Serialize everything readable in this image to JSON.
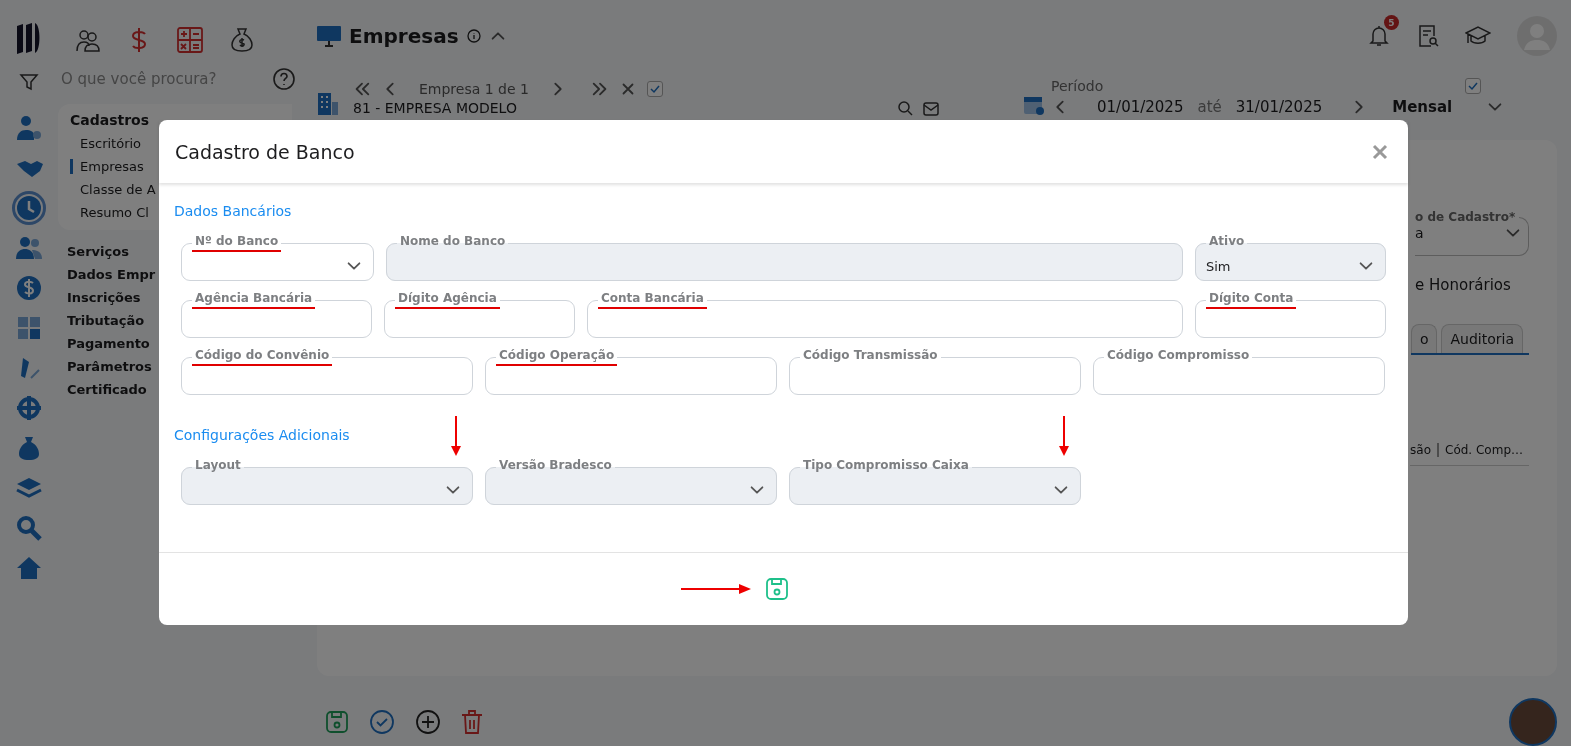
{
  "rail": [
    {
      "selected": false
    },
    {
      "selected": false
    },
    {
      "selected": true
    },
    {
      "selected": false
    },
    {
      "selected": false
    },
    {
      "selected": false
    },
    {
      "selected": false
    },
    {
      "selected": false
    },
    {
      "selected": false
    },
    {
      "selected": false
    },
    {
      "selected": false
    },
    {
      "selected": false
    }
  ],
  "search": {
    "placeholder": "O que você procura?"
  },
  "sidebar": {
    "group_title": "Cadastros",
    "items": [
      {
        "label": "Escritório",
        "selected": false
      },
      {
        "label": "Empresas",
        "selected": true
      },
      {
        "label": "Classe de A",
        "selected": false
      },
      {
        "label": "Resumo Cl",
        "selected": false
      }
    ],
    "sections": [
      "Serviços",
      "Dados Empr",
      "Inscrições",
      "Tributação",
      "Pagamento",
      "Parâmetros",
      "Certificado"
    ]
  },
  "header": {
    "title": "Empresas",
    "notifications": "5"
  },
  "company_nav": {
    "position": "Empresa 1 de 1",
    "checked": true,
    "company": "81 - EMPRESA MODELO"
  },
  "period": {
    "label": "Período",
    "start": "01/01/2025",
    "separator": "até",
    "end": "31/01/2025",
    "mode": "Mensal",
    "checked": true
  },
  "panel": {
    "select_label": "o de Cadastro*",
    "select_value": "a",
    "option_label": "e Honorários",
    "tabs": [
      {
        "label": "o",
        "selected": false
      },
      {
        "label": "Auditoria",
        "selected": false
      }
    ],
    "columns": [
      "são",
      "Cód. Comp…"
    ]
  },
  "modal": {
    "title": "Cadastro de Banco",
    "save_arrowed": true,
    "sections": [
      {
        "title": "Dados Bancários",
        "fields": [
          {
            "label": "Nº do Banco",
            "kind": "select",
            "disabled": false,
            "underlined": true,
            "arrowed": false
          },
          {
            "label": "Nome do Banco",
            "kind": "text",
            "disabled": true,
            "underlined": false,
            "arrowed": false
          },
          {
            "label": "Ativo",
            "kind": "select",
            "value": "Sim",
            "disabled": true,
            "underlined": false,
            "arrowed": false
          },
          {
            "label": "Agência Bancária",
            "kind": "text",
            "disabled": false,
            "underlined": true,
            "arrowed": false
          },
          {
            "label": "Dígito Agência",
            "kind": "text",
            "disabled": false,
            "underlined": true,
            "arrowed": false
          },
          {
            "label": "Conta Bancária",
            "kind": "text",
            "disabled": false,
            "underlined": true,
            "arrowed": false
          },
          {
            "label": "Dígito Conta",
            "kind": "text",
            "disabled": false,
            "underlined": true,
            "arrowed": false
          },
          {
            "label": "Código do Convênio",
            "kind": "text",
            "disabled": false,
            "underlined": true,
            "arrowed": false
          },
          {
            "label": "Código Operação",
            "kind": "text",
            "disabled": false,
            "underlined": true,
            "arrowed": false
          },
          {
            "label": "Código Transmissão",
            "kind": "text",
            "disabled": false,
            "underlined": false,
            "arrowed": false
          },
          {
            "label": "Código Compromisso",
            "kind": "text",
            "disabled": false,
            "underlined": false,
            "arrowed": false
          }
        ]
      },
      {
        "title": "Configurações Adicionais",
        "fields": [
          {
            "label": "Layout",
            "kind": "select",
            "disabled": true,
            "underlined": false,
            "arrowed": true
          },
          {
            "label": "Versão Bradesco",
            "kind": "select",
            "disabled": true,
            "underlined": false,
            "arrowed": false
          },
          {
            "label": "Tipo Compromisso Caixa",
            "kind": "select",
            "disabled": true,
            "underlined": false,
            "arrowed": true
          }
        ]
      }
    ]
  }
}
